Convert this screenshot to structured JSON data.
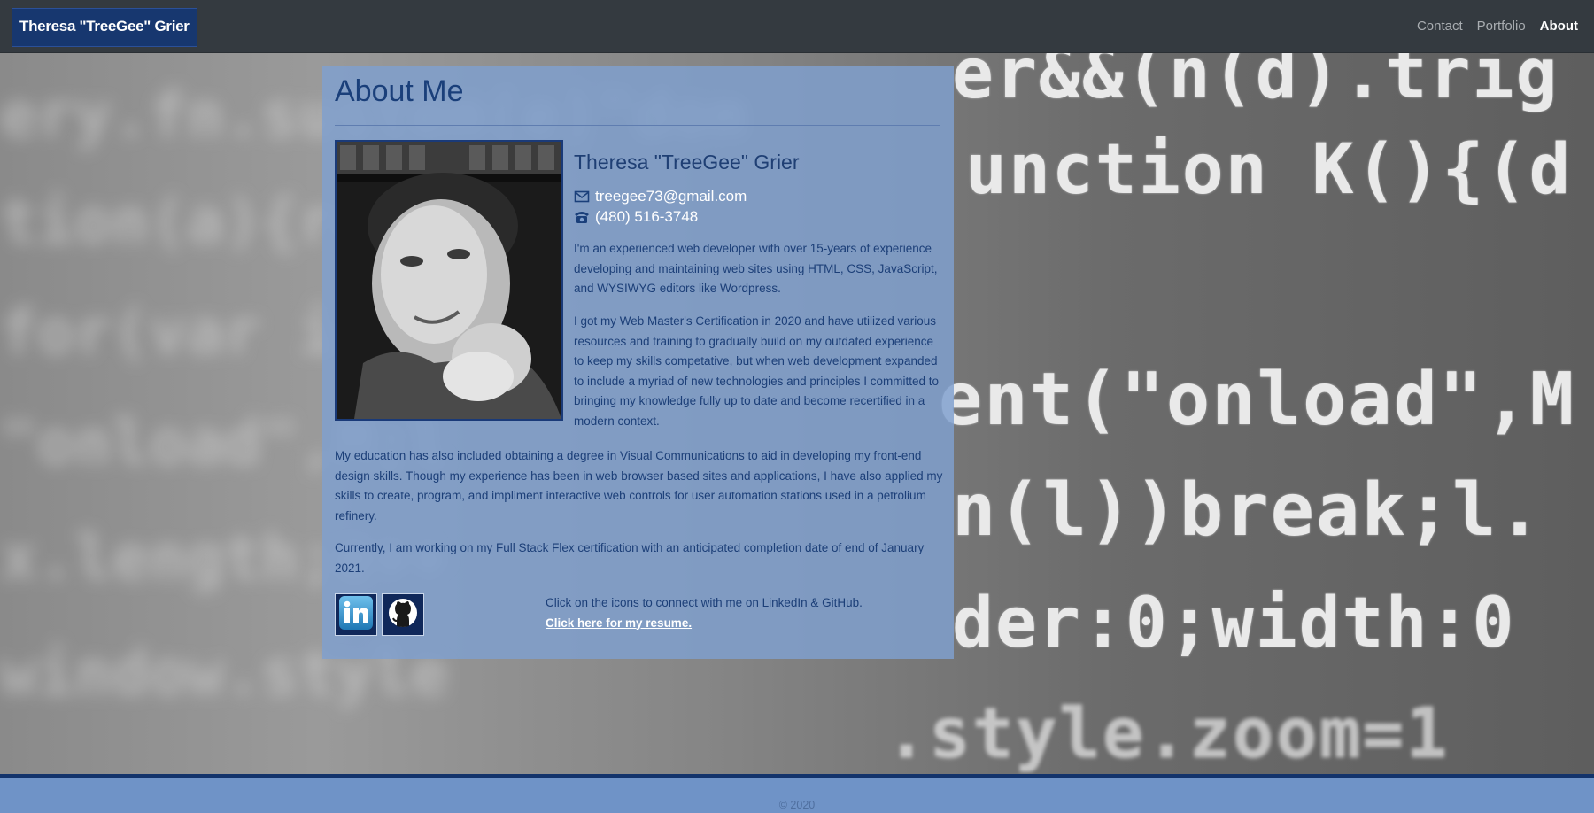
{
  "navbar": {
    "brand": "Theresa \"TreeGee\" Grier",
    "links": [
      {
        "label": "Contact",
        "active": false
      },
      {
        "label": "Portfolio",
        "active": false
      },
      {
        "label": "About",
        "active": true
      }
    ]
  },
  "about": {
    "heading": "About Me",
    "name": "Theresa \"TreeGee\" Grier",
    "email": "treegee73@gmail.com",
    "phone": "(480) 516-3748",
    "paragraphs": [
      "I'm an experienced web developer with over 15-years of experience developing and maintaining web sites using HTML, CSS, JavaScript, and WYSIWYG editors like Wordpress.",
      "I got my Web Master's Certification in 2020 and have utilized various resources and training to gradually build on my outdated experience to keep my skills competative, but when web development expanded to include a myriad of new technologies and principles I committed to bringing my knowledge fully up to date and become recertified in a modern context.",
      "My education has also included obtaining a degree in Visual Communications to aid in developing my front-end design skills. Though my experience has been in web browser based sites and applications, I have also applied my skills to create, program, and impliment interactive web controls for user automation stations used in a petrolium refinery.",
      "Currently, I am working on my Full Stack Flex certification with an anticipated completion date of end of January 2021."
    ],
    "social": [
      {
        "name": "LinkedIn",
        "icon": "linkedin-icon"
      },
      {
        "name": "GitHub",
        "icon": "github-icon"
      }
    ],
    "connect_text": "Click on the icons to connect with me on LinkedIn & GitHub.",
    "resume_link": "Click here for my resume."
  },
  "footer": {
    "copyright": "© 2020"
  },
  "colors": {
    "navbar": "#343a40",
    "brand_bg": "#17376f",
    "card_bg": "#80a0ce",
    "text_blue": "#1c3f78",
    "footer_bg": "#6f93c7",
    "footer_border": "#13336b"
  }
}
